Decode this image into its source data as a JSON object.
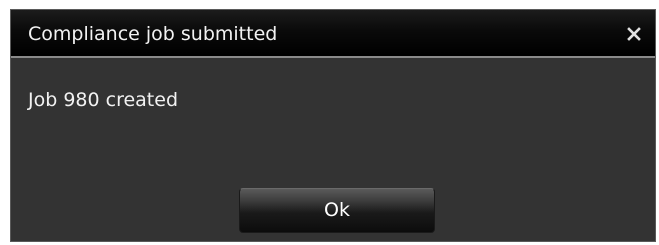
{
  "dialog": {
    "title": "Compliance job submitted",
    "close_icon": "close-icon",
    "message": "Job 980 created",
    "ok_label": "Ok"
  },
  "colors": {
    "dialog_background": "#333333",
    "titlebar_background": "#000000",
    "text": "#f2f2f2"
  }
}
